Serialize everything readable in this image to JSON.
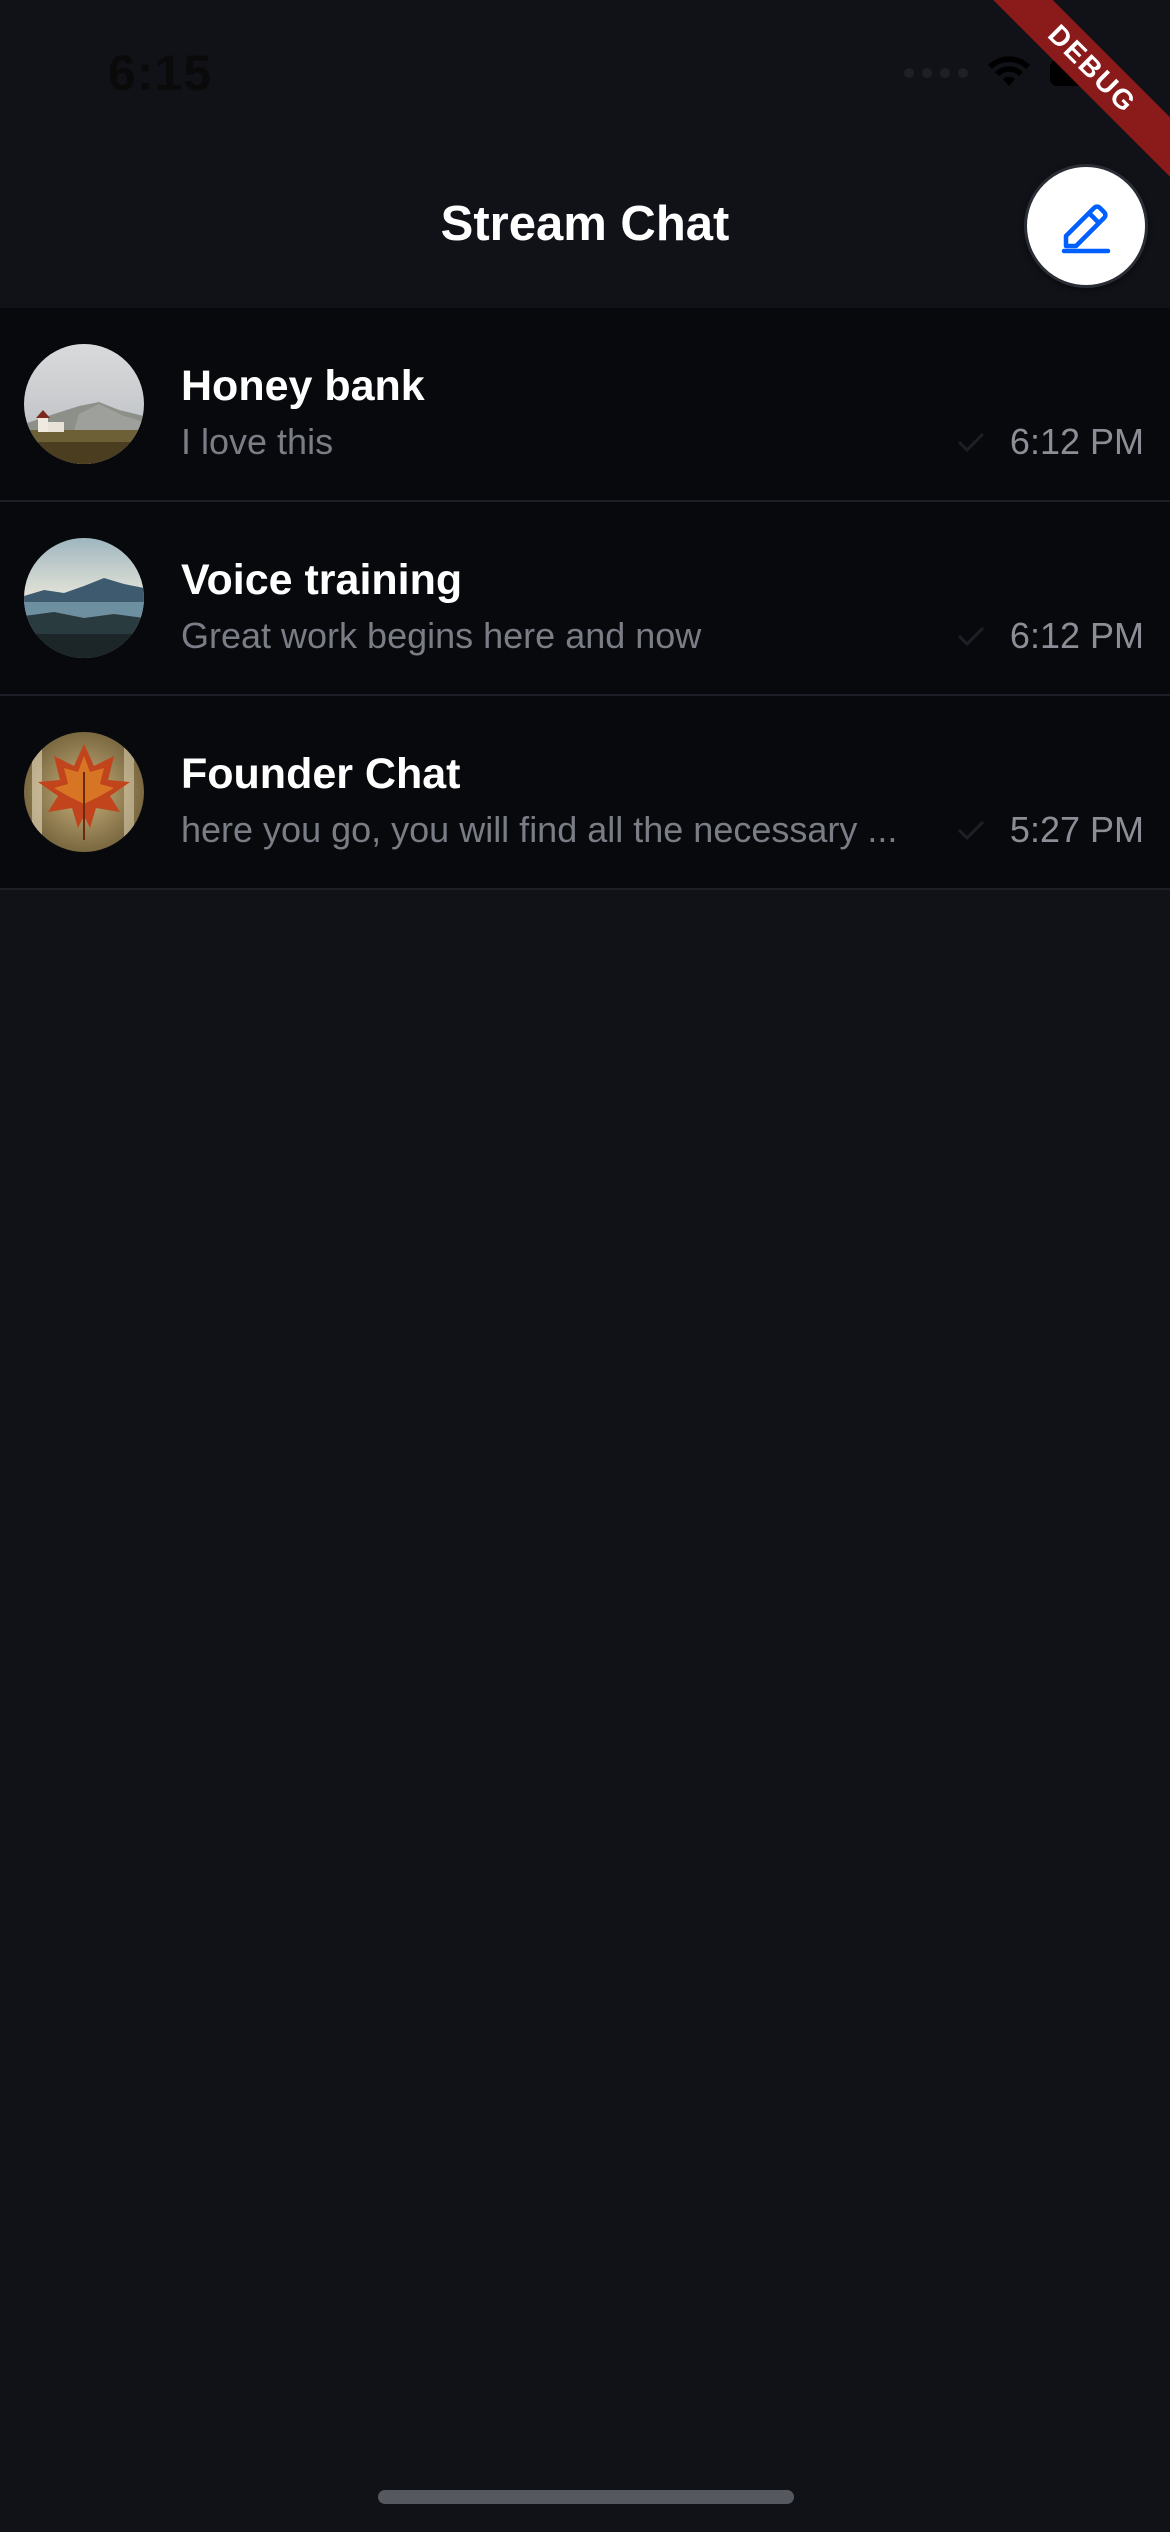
{
  "status_bar": {
    "time": "6:15"
  },
  "debug_banner": {
    "label": "DEBUG"
  },
  "header": {
    "title": "Stream Chat",
    "compose_icon": "pencil-icon"
  },
  "channels": [
    {
      "name": "Honey bank",
      "preview": "I love this",
      "time": "6:12 PM",
      "status_icon": "check-icon",
      "avatar": "mountain-church-photo"
    },
    {
      "name": "Voice training",
      "preview": "Great work begins here and now",
      "time": "6:12 PM",
      "status_icon": "check-icon",
      "avatar": "lake-mountains-photo"
    },
    {
      "name": "Founder Chat",
      "preview": "here you go, you will find all the necessary ...",
      "time": "5:27 PM",
      "status_icon": "check-icon",
      "avatar": "autumn-leaf-photo"
    }
  ],
  "colors": {
    "background": "#101218",
    "row_background": "#07090c",
    "accent": "#005fff",
    "debug_red": "#8b1a1a"
  }
}
